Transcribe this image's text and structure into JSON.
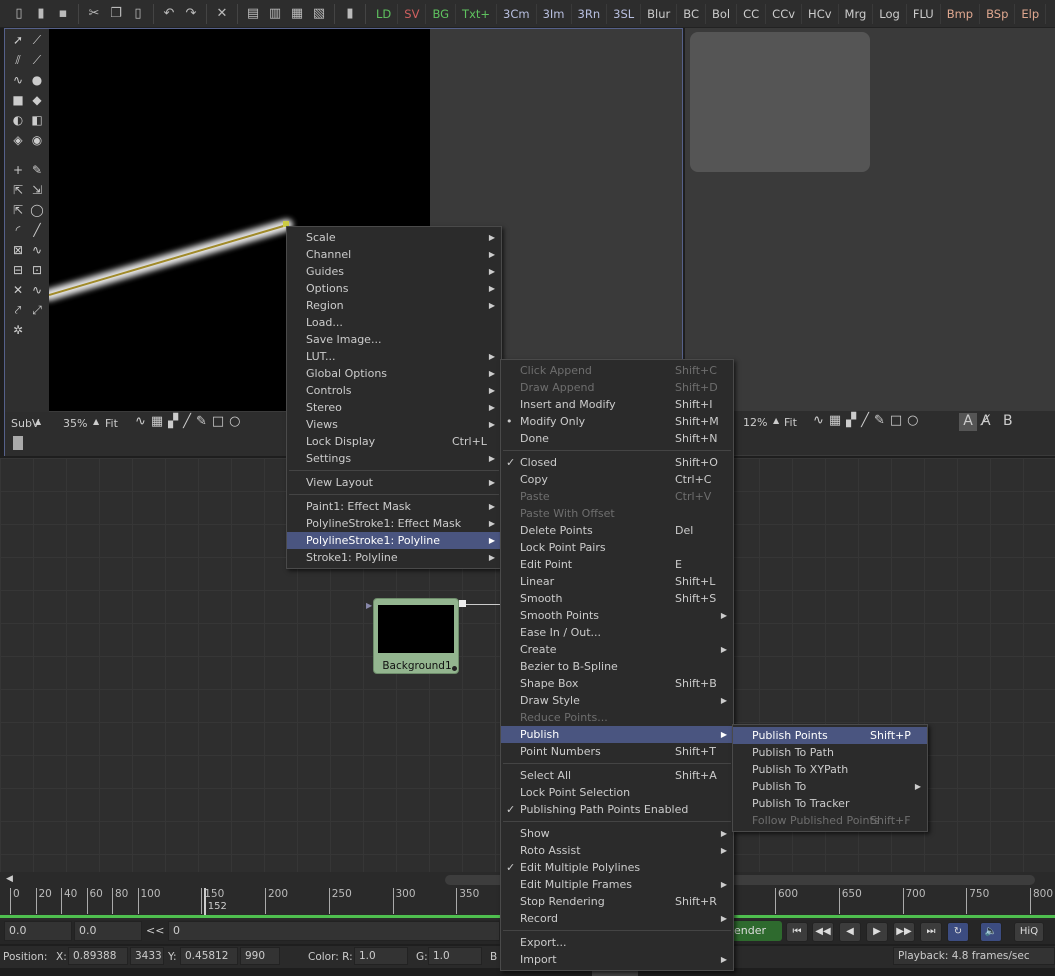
{
  "toolbar": {
    "icons": [
      "new-file-icon",
      "open-file-icon",
      "save-icon",
      "cut-icon",
      "copy-icon",
      "paste-icon",
      "undo-icon",
      "redo-icon",
      "delete-icon",
      "layout-1-icon",
      "layout-2-icon",
      "layout-3-icon",
      "layout-4-icon",
      "script-icon"
    ],
    "buttons": [
      {
        "label": "LD",
        "color": "#5fc25f"
      },
      {
        "label": "SV",
        "color": "#d06060"
      },
      {
        "label": "BG",
        "color": "#5fc25f"
      },
      {
        "label": "Txt+",
        "color": "#5fc25f"
      },
      {
        "label": "3Cm",
        "color": "#b8bfe0"
      },
      {
        "label": "3Im",
        "color": "#b8bfe0"
      },
      {
        "label": "3Rn",
        "color": "#b8bfe0"
      },
      {
        "label": "3SL",
        "color": "#b8bfe0"
      },
      {
        "label": "Blur",
        "color": "#cccccc"
      },
      {
        "label": "BC",
        "color": "#cccccc"
      },
      {
        "label": "Bol",
        "color": "#cccccc"
      },
      {
        "label": "CC",
        "color": "#cccccc"
      },
      {
        "label": "CCv",
        "color": "#cccccc"
      },
      {
        "label": "HCv",
        "color": "#cccccc"
      },
      {
        "label": "Mrg",
        "color": "#cccccc"
      },
      {
        "label": "Log",
        "color": "#cccccc"
      },
      {
        "label": "FLU",
        "color": "#cccccc"
      },
      {
        "label": "Bmp",
        "color": "#e0a890"
      },
      {
        "label": "BSp",
        "color": "#e0a890"
      },
      {
        "label": "Elp",
        "color": "#e0a890"
      }
    ]
  },
  "viewer1": {
    "subv": "SubV",
    "zoom": "35%",
    "fit": "Fit"
  },
  "viewer2": {
    "zoom": "12%",
    "fit": "Fit",
    "text_a": "A",
    "text_b": "B"
  },
  "node": {
    "label": "Background1"
  },
  "main_menu": [
    {
      "label": "Scale",
      "sub": true
    },
    {
      "label": "Channel",
      "sub": true
    },
    {
      "label": "Guides",
      "sub": true
    },
    {
      "label": "Options",
      "sub": true
    },
    {
      "label": "Region",
      "sub": true
    },
    {
      "label": "Load..."
    },
    {
      "label": "Save Image..."
    },
    {
      "label": "LUT...",
      "sub": true
    },
    {
      "label": "Global Options",
      "sub": true
    },
    {
      "label": "Controls",
      "sub": true
    },
    {
      "label": "Stereo",
      "sub": true
    },
    {
      "label": "Views",
      "sub": true
    },
    {
      "label": "Lock Display",
      "shortcut": "Ctrl+L"
    },
    {
      "label": "Settings",
      "sub": true
    },
    {
      "sep": true
    },
    {
      "label": "View Layout",
      "sub": true
    },
    {
      "sep": true
    },
    {
      "label": "Paint1: Effect Mask",
      "sub": true
    },
    {
      "label": "PolylineStroke1: Effect Mask",
      "sub": true
    },
    {
      "label": "PolylineStroke1: Polyline",
      "sub": true,
      "hl": true
    },
    {
      "label": "Stroke1: Polyline",
      "sub": true
    }
  ],
  "polyline_menu": [
    {
      "label": "Click Append",
      "shortcut": "Shift+C",
      "dis": true
    },
    {
      "label": "Draw Append",
      "shortcut": "Shift+D",
      "dis": true
    },
    {
      "label": "Insert and Modify",
      "shortcut": "Shift+I"
    },
    {
      "label": "Modify Only",
      "shortcut": "Shift+M",
      "mark": "•"
    },
    {
      "label": "Done",
      "shortcut": "Shift+N"
    },
    {
      "sep": true
    },
    {
      "label": "Closed",
      "shortcut": "Shift+O",
      "mark": "✓"
    },
    {
      "label": "Copy",
      "shortcut": "Ctrl+C"
    },
    {
      "label": "Paste",
      "shortcut": "Ctrl+V",
      "dis": true
    },
    {
      "label": "Paste With Offset",
      "dis": true
    },
    {
      "label": "Delete Points",
      "shortcut": "Del"
    },
    {
      "label": "Lock Point Pairs"
    },
    {
      "label": "Edit Point",
      "shortcut": "E"
    },
    {
      "label": "Linear",
      "shortcut": "Shift+L"
    },
    {
      "label": "Smooth",
      "shortcut": "Shift+S"
    },
    {
      "label": "Smooth Points",
      "sub": true
    },
    {
      "label": "Ease In / Out..."
    },
    {
      "label": "Create",
      "sub": true
    },
    {
      "label": "Bezier to B-Spline"
    },
    {
      "label": "Shape Box",
      "shortcut": "Shift+B"
    },
    {
      "label": "Draw Style",
      "sub": true
    },
    {
      "label": "Reduce Points...",
      "dis": true
    },
    {
      "label": "Publish",
      "sub": true,
      "hl": true
    },
    {
      "label": "Point Numbers",
      "shortcut": "Shift+T"
    },
    {
      "sep": true
    },
    {
      "label": "Select All",
      "shortcut": "Shift+A"
    },
    {
      "label": "Lock Point Selection"
    },
    {
      "label": "Publishing Path Points Enabled",
      "mark": "✓"
    },
    {
      "sep": true
    },
    {
      "label": "Show",
      "sub": true
    },
    {
      "label": "Roto Assist",
      "sub": true
    },
    {
      "label": "Edit Multiple Polylines",
      "mark": "✓"
    },
    {
      "label": "Edit Multiple Frames",
      "sub": true
    },
    {
      "label": "Stop Rendering",
      "shortcut": "Shift+R"
    },
    {
      "label": "Record",
      "sub": true
    },
    {
      "sep": true
    },
    {
      "label": "Export..."
    },
    {
      "label": "Import",
      "sub": true
    }
  ],
  "publish_menu": [
    {
      "label": "Publish Points",
      "shortcut": "Shift+P",
      "hl": true
    },
    {
      "label": "Publish To Path"
    },
    {
      "label": "Publish To XYPath"
    },
    {
      "label": "Publish To",
      "sub": true
    },
    {
      "label": "Publish To Tracker"
    },
    {
      "label": "Follow Published Points",
      "shortcut": "Shift+F",
      "dis": true
    }
  ],
  "timeline": {
    "ticks": [
      0,
      20,
      40,
      60,
      80,
      100,
      150,
      200,
      250,
      300,
      350,
      600,
      650,
      700,
      750,
      800
    ],
    "current_frame": "152"
  },
  "controls": {
    "start": "0.0",
    "end": "0.0",
    "rewind": "<<",
    "frame": "0",
    "render": "ender",
    "hiq": "HiQ"
  },
  "status": {
    "position_label": "Position:",
    "x_label": "X:",
    "x": "0.89388",
    "x_px": "3433",
    "y_label": "Y:",
    "y": "0.45812",
    "y_px": "990",
    "color_label": "Color: R:",
    "r": "1.0",
    "g_label": "G:",
    "g": "1.0",
    "b_label": "B",
    "playback": "Playback: 4.8 frames/sec"
  },
  "accent": "#4a5580"
}
